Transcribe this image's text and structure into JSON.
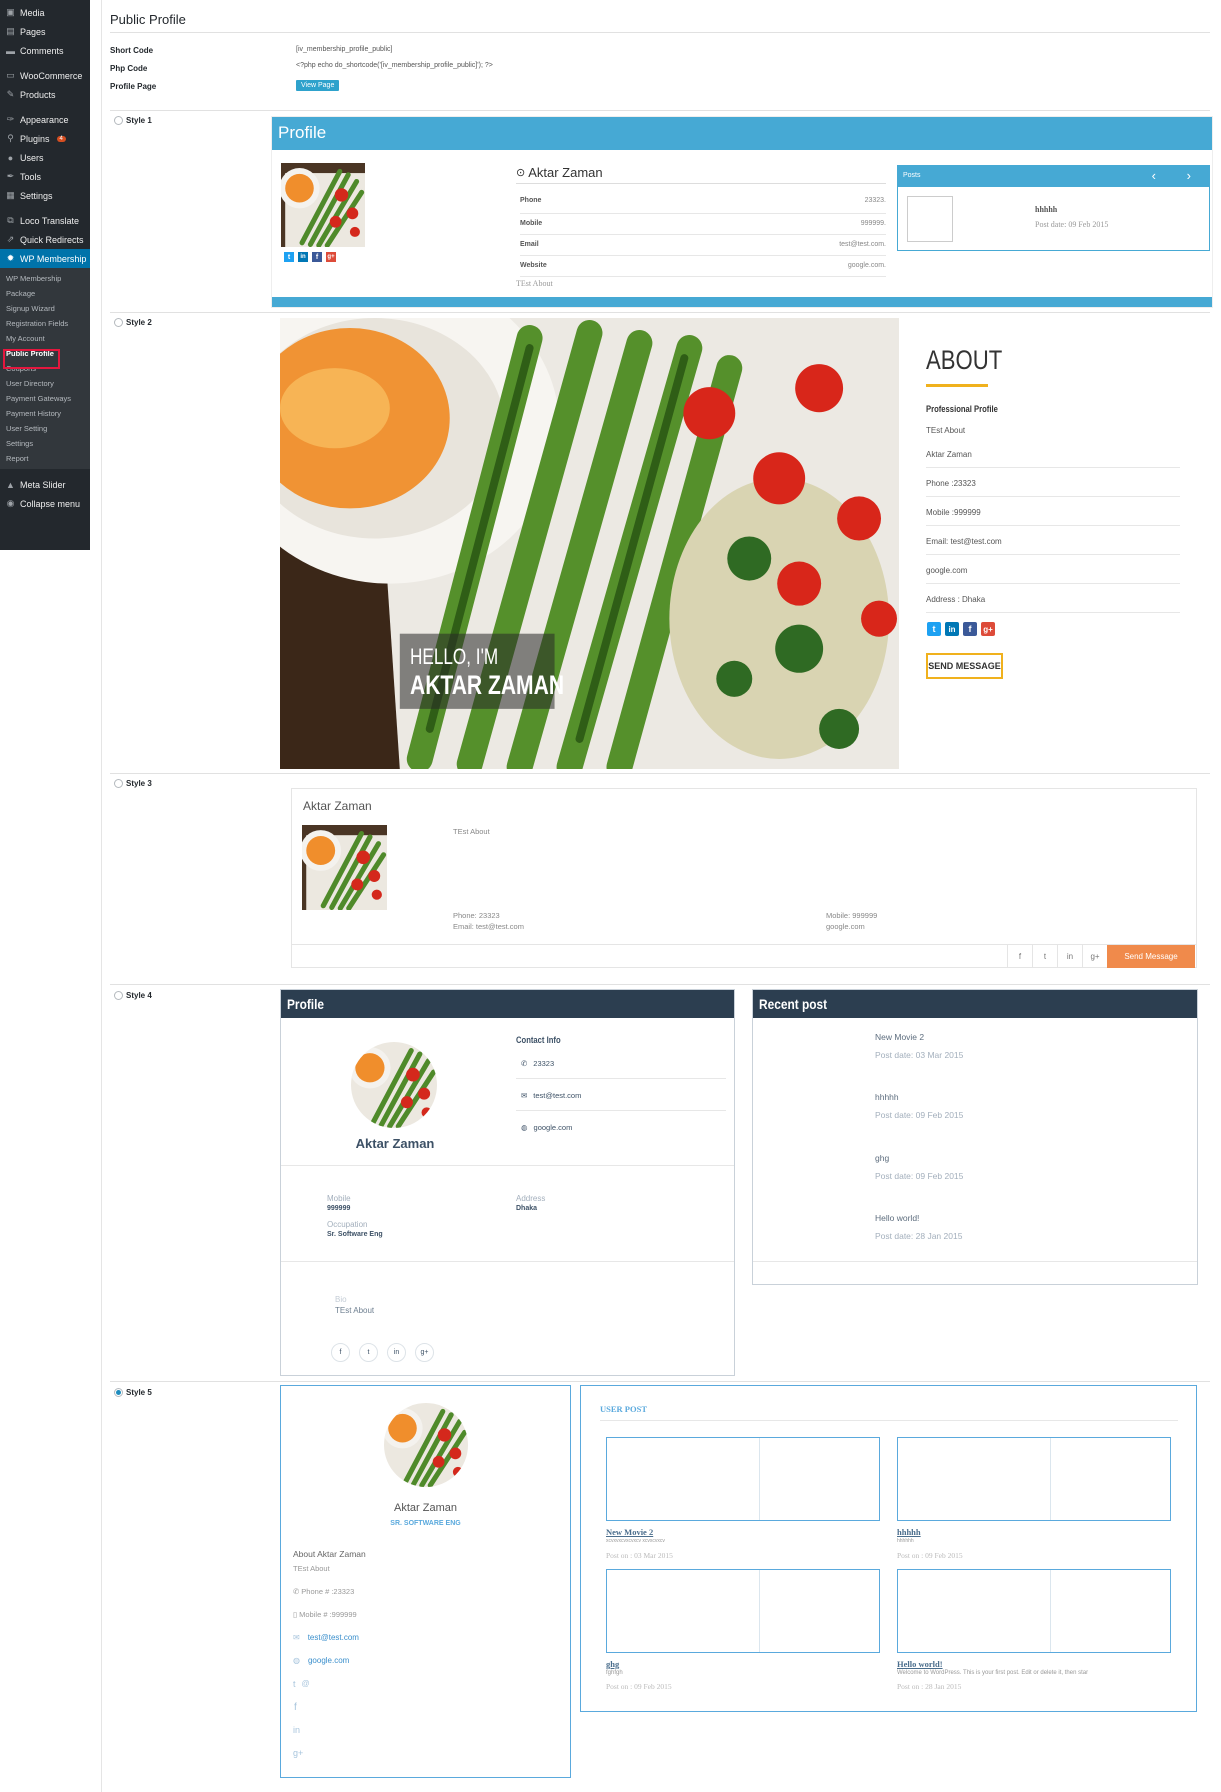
{
  "sidebar": {
    "items": [
      {
        "label": "Media",
        "icon": "media-icon"
      },
      {
        "label": "Pages",
        "icon": "pages-icon"
      },
      {
        "label": "Comments",
        "icon": "comments-icon"
      },
      {
        "label": "WooCommerce",
        "icon": "woocommerce-icon"
      },
      {
        "label": "Products",
        "icon": "products-icon"
      },
      {
        "label": "Appearance",
        "icon": "appearance-icon"
      },
      {
        "label": "Plugins",
        "icon": "plugins-icon",
        "badge": "4"
      },
      {
        "label": "Users",
        "icon": "users-icon"
      },
      {
        "label": "Tools",
        "icon": "tools-icon"
      },
      {
        "label": "Settings",
        "icon": "settings-icon"
      },
      {
        "label": "Loco Translate",
        "icon": "translate-icon"
      },
      {
        "label": "Quick Redirects",
        "icon": "redirect-icon"
      },
      {
        "label": "WP Membership",
        "icon": "gear-icon"
      }
    ],
    "sub_items": [
      "WP Membership",
      "Package",
      "Signup Wizard",
      "Registration Fields",
      "My Account",
      "Public Profile",
      "Coupons",
      "User Directory",
      "Payment Gateways",
      "Payment History",
      "User Setting",
      "Settings",
      "Report"
    ],
    "after": [
      {
        "label": "Meta Slider",
        "icon": "meta-slider-icon"
      },
      {
        "label": "Collapse menu",
        "icon": "collapse-icon"
      }
    ]
  },
  "page": {
    "title": "Public Profile",
    "short_code_label": "Short Code",
    "short_code_value": "[iv_membership_profile_public]",
    "php_code_label": "Php Code",
    "php_code_value": "<?php echo do_shortcode('[iv_membership_profile_public]'); ?>",
    "profile_page_label": "Profile Page",
    "view_page_button": "View Page"
  },
  "styles": {
    "s1_label": "Style 1",
    "s2_label": "Style 2",
    "s3_label": "Style 3",
    "s4_label": "Style 4",
    "s5_label": "Style 5",
    "selected": "Style 5"
  },
  "style1": {
    "header": "Profile",
    "name": "Aktar Zaman",
    "rows": [
      {
        "label": "Phone",
        "value": "23323."
      },
      {
        "label": "Mobile",
        "value": "999999."
      },
      {
        "label": "Email",
        "value": "test@test.com."
      },
      {
        "label": "Website",
        "value": "google.com."
      }
    ],
    "about": "TEst About",
    "posts_header": "Posts",
    "post_title": "hhhhh",
    "post_date": "Post date: 09 Feb 2015"
  },
  "style2": {
    "hello": "HELLO, I'M",
    "name": "AKTAR ZAMAN",
    "about_title": "ABOUT",
    "professional": "Professional Profile",
    "about_text": "TEst About",
    "name_line": "Aktar Zaman",
    "phone": "Phone :23323",
    "mobile": "Mobile :999999",
    "email": "Email: test@test.com",
    "website": "google.com",
    "address": "Address : Dhaka",
    "send": "SEND MESSAGE"
  },
  "style3": {
    "name": "Aktar Zaman",
    "about": "TEst About",
    "phone": "Phone: 23323",
    "email": "Email: test@test.com",
    "mobile": "Mobile: 999999",
    "website": "google.com",
    "send": "Send Message"
  },
  "style4": {
    "profile_header": "Profile",
    "recent_header": "Recent post",
    "contact_info": "Contact Info",
    "phone": "23323",
    "email": "test@test.com",
    "website": "google.com",
    "name": "Aktar Zaman",
    "mobile_label": "Mobile",
    "mobile": "999999",
    "occupation_label": "Occupation",
    "occupation": "Sr. Software Eng",
    "address_label": "Address",
    "address": "Dhaka",
    "bio_label": "Bio",
    "bio": "TEst About",
    "posts": [
      {
        "title": "New Movie 2",
        "date": "Post date: 03 Mar 2015"
      },
      {
        "title": "hhhhh",
        "date": "Post date: 09 Feb 2015"
      },
      {
        "title": "ghg",
        "date": "Post date: 09 Feb 2015"
      },
      {
        "title": "Hello world!",
        "date": "Post date: 28 Jan 2015"
      }
    ]
  },
  "style5": {
    "name": "Aktar Zaman",
    "role": "SR. SOFTWARE ENG",
    "about_title": "About Aktar Zaman",
    "about": "TEst About",
    "phone": "Phone # :23323",
    "mobile": "Mobile # :999999",
    "email": "test@test.com",
    "website": "google.com",
    "user_post": "USER POST",
    "posts": [
      {
        "title": "New Movie 2",
        "excerpt": "xcvxvxcvxcvxcv xcvxcvxcv",
        "date": "Post on : 03 Mar 2015"
      },
      {
        "title": "hhhhh",
        "excerpt": "hhhhhh",
        "date": "Post on : 09 Feb 2015"
      },
      {
        "title": "ghg",
        "excerpt": "fghfgh",
        "date": "Post on : 09 Feb 2015"
      },
      {
        "title": "Hello world!",
        "excerpt": "Welcome to WordPress. This is your first post. Edit or delete it, then star",
        "date": "Post on : 28 Jan 2015"
      }
    ]
  },
  "colors": {
    "wp_blue": "#0073aa",
    "style1_blue": "#46a9d4",
    "style4_navy": "#2c3e50",
    "style2_gold": "#f0b11d",
    "style3_orange": "#f08a4b",
    "twitter": "#1da1f2",
    "linkedin": "#0077b5",
    "facebook": "#3b5998",
    "google": "#dd4b39"
  }
}
